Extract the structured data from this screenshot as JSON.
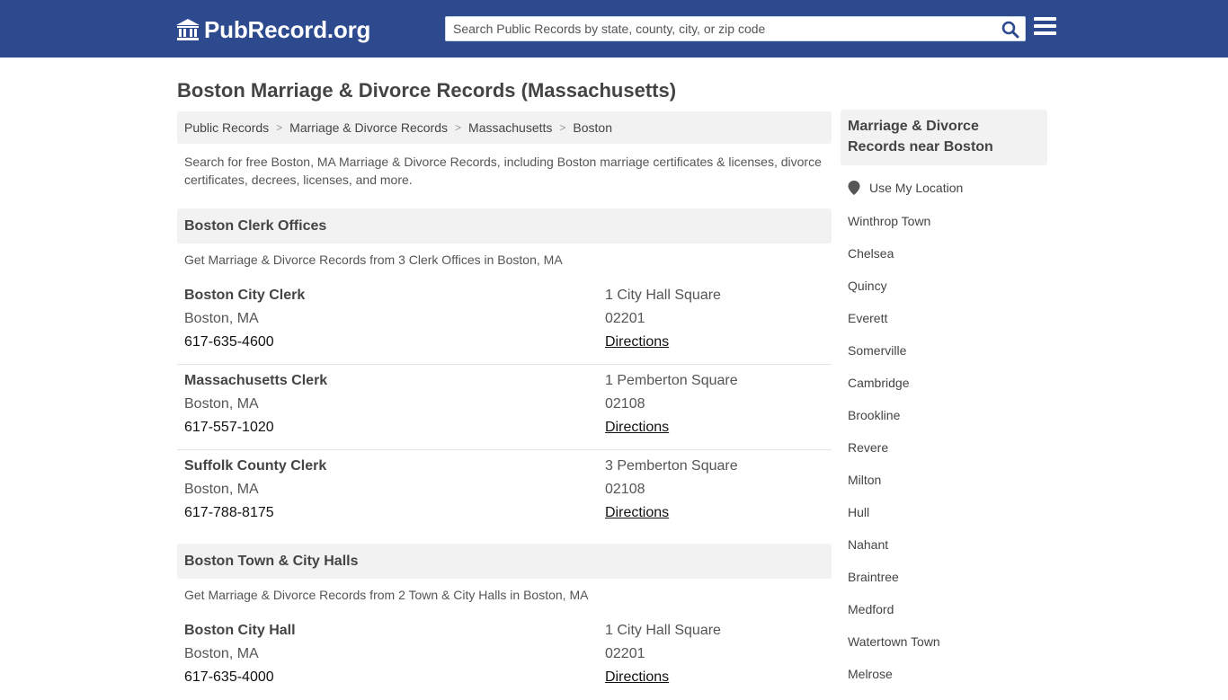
{
  "header": {
    "logo_text": "PubRecord.org",
    "search_placeholder": "Search Public Records by state, county, city, or zip code",
    "search_icon": "search-icon",
    "menu_icon": "hamburger-menu-icon"
  },
  "colors": {
    "header_bg": "#2e4a8f",
    "panel_bg": "#f2f2f2"
  },
  "page_title": "Boston Marriage & Divorce Records (Massachusetts)",
  "breadcrumb": [
    "Public Records",
    "Marriage & Divorce Records",
    "Massachusetts",
    "Boston"
  ],
  "intro": "Search for free Boston, MA Marriage & Divorce Records, including Boston marriage certificates & licenses, divorce certificates, decrees, licenses, and more.",
  "sections": [
    {
      "title": "Boston Clerk Offices",
      "subtitle": "Get Marriage & Divorce Records from 3 Clerk Offices in Boston, MA",
      "offices": [
        {
          "name": "Boston City Clerk",
          "city": "Boston, MA",
          "phone": "617-635-4600",
          "address": "1 City Hall Square",
          "zip": "02201",
          "link": "Directions"
        },
        {
          "name": "Massachusetts Clerk",
          "city": "Boston, MA",
          "phone": "617-557-1020",
          "address": "1 Pemberton Square",
          "zip": "02108",
          "link": "Directions"
        },
        {
          "name": "Suffolk County Clerk",
          "city": "Boston, MA",
          "phone": "617-788-8175",
          "address": "3 Pemberton Square",
          "zip": "02108",
          "link": "Directions"
        }
      ]
    },
    {
      "title": "Boston Town & City Halls",
      "subtitle": "Get Marriage & Divorce Records from 2 Town & City Halls in Boston, MA",
      "offices": [
        {
          "name": "Boston City Hall",
          "city": "Boston, MA",
          "phone": "617-635-4000",
          "address": "1 City Hall Square",
          "zip": "02201",
          "link": "Directions"
        }
      ]
    }
  ],
  "sidebar": {
    "title": "Marriage & Divorce Records near Boston",
    "use_location": "Use My Location",
    "location_icon": "map-marker-icon",
    "nearby": [
      "Winthrop Town",
      "Chelsea",
      "Quincy",
      "Everett",
      "Somerville",
      "Cambridge",
      "Brookline",
      "Revere",
      "Milton",
      "Hull",
      "Nahant",
      "Braintree",
      "Medford",
      "Watertown Town",
      "Melrose"
    ]
  }
}
